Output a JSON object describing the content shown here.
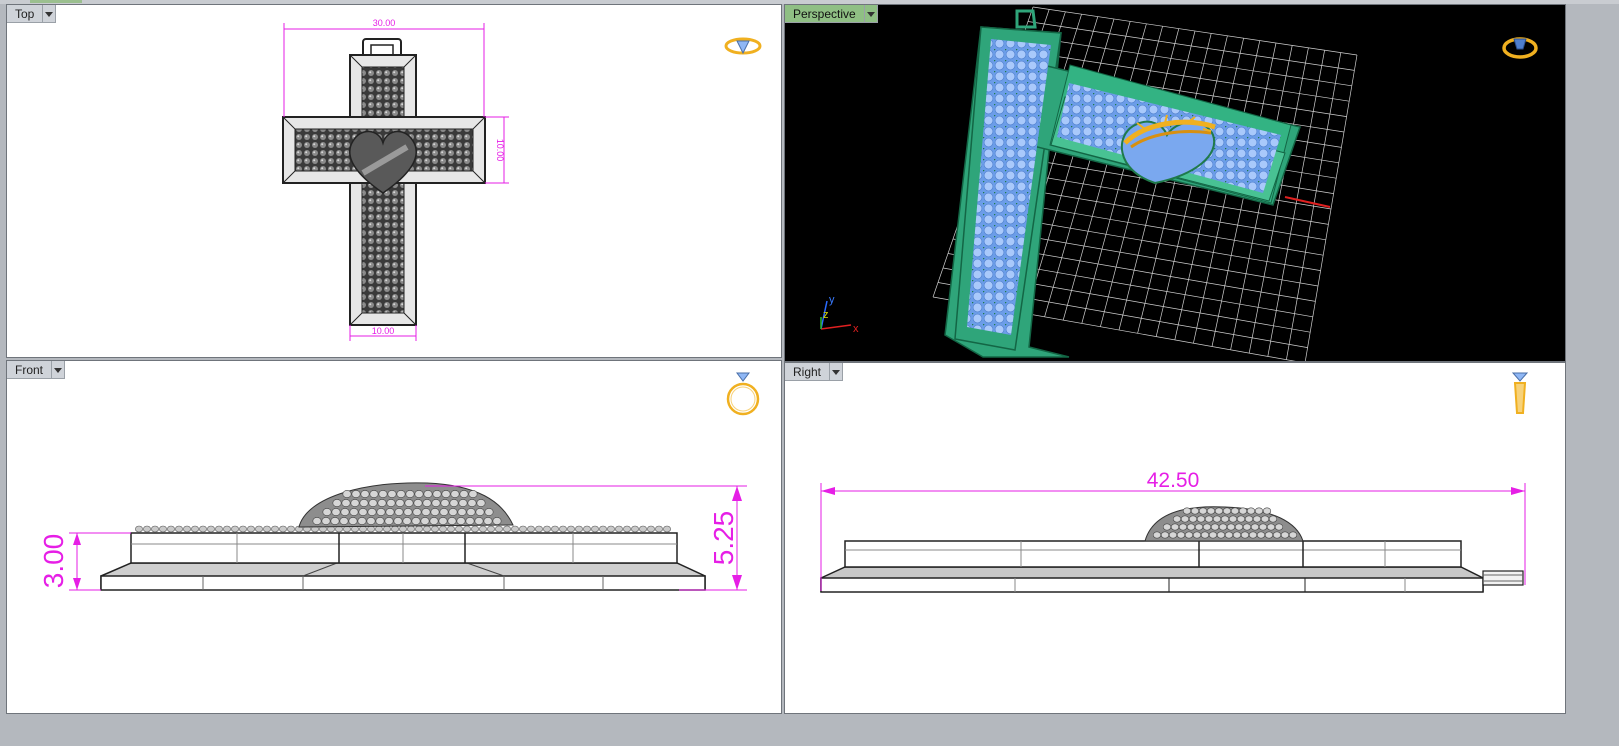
{
  "viewports": {
    "top": {
      "label": "Top"
    },
    "perspective": {
      "label": "Perspective"
    },
    "front": {
      "label": "Front"
    },
    "right": {
      "label": "Right"
    }
  },
  "dimensions": {
    "top_width": "30.00",
    "top_arm": "10.00",
    "top_bottom": "10.00",
    "front_total": "5.25",
    "front_base": "3.00",
    "right_length": "42.50"
  },
  "axes": {
    "x": "x",
    "y": "y",
    "z": "z"
  },
  "colors": {
    "dimension": "#e61ee6",
    "cross_green": "#2fa57a",
    "gem_blue": "#8fb7f5",
    "gold": "#f0b020",
    "active_label": "#8fbf84"
  },
  "icons": {
    "top": "ring-top-view-icon",
    "perspective": "ring-perspective-icon",
    "front": "ring-front-view-icon",
    "right": "ring-side-view-icon"
  }
}
